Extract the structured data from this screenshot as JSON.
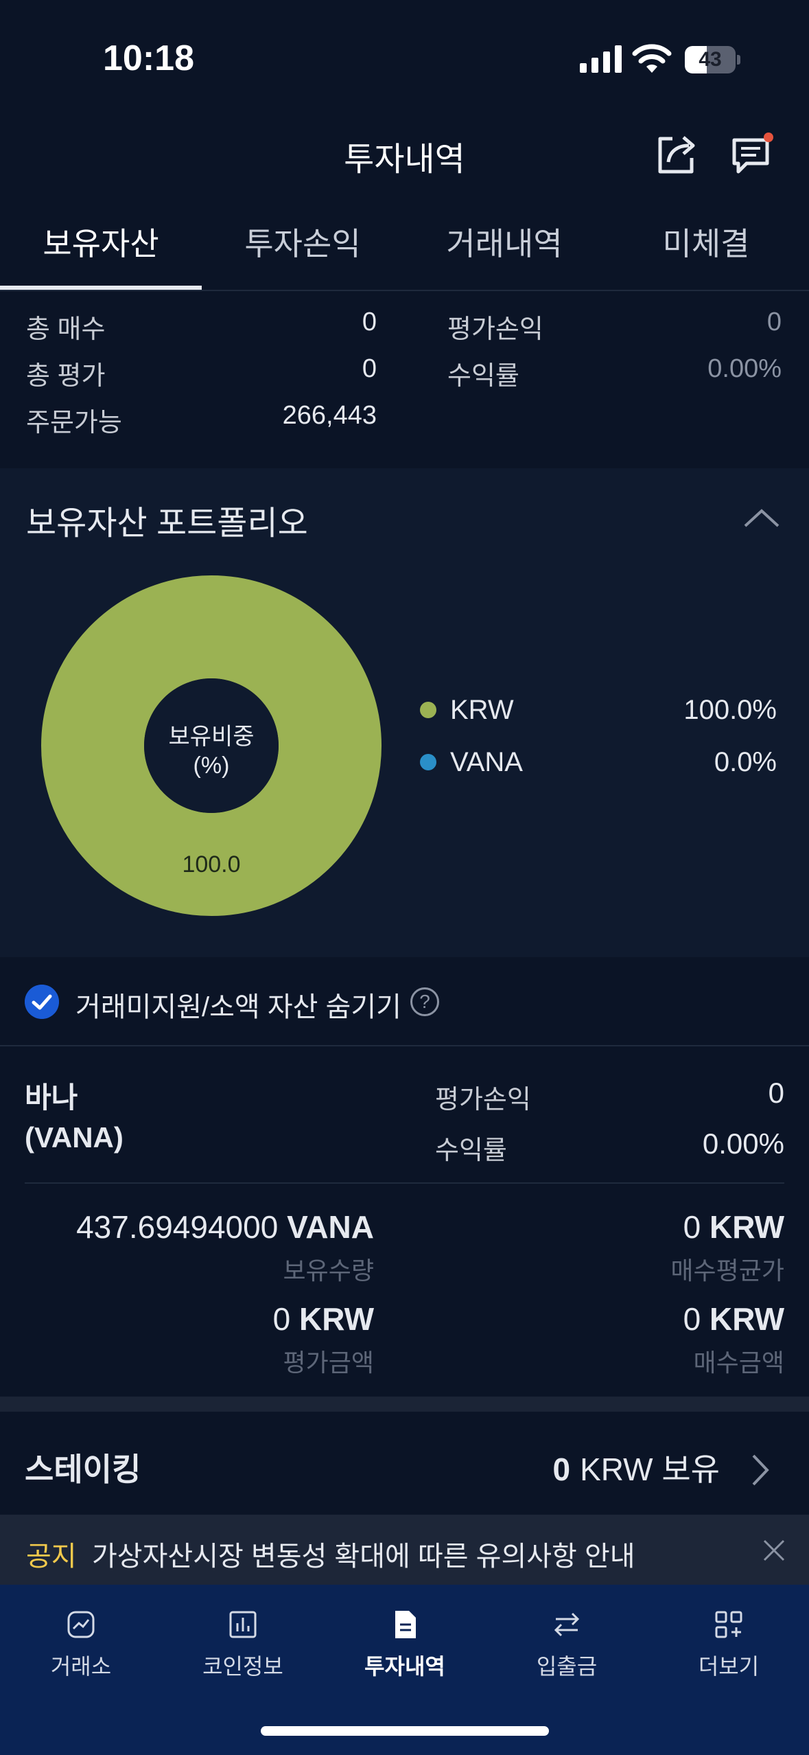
{
  "status_bar": {
    "time": "10:18",
    "battery": "43",
    "battery_level_percent": 43
  },
  "header": {
    "title": "투자내역"
  },
  "tabs": [
    {
      "label": "보유자산",
      "active": true
    },
    {
      "label": "투자손익",
      "active": false
    },
    {
      "label": "거래내역",
      "active": false
    },
    {
      "label": "미체결",
      "active": false
    }
  ],
  "summary": {
    "total_buy_label": "총 매수",
    "total_buy_value": "0",
    "total_eval_label": "총 평가",
    "total_eval_value": "0",
    "orderable_label": "주문가능",
    "orderable_value": "266,443",
    "pnl_label": "평가손익",
    "pnl_value": "0",
    "return_label": "수익률",
    "return_value": "0.00%"
  },
  "portfolio": {
    "title": "보유자산 포트폴리오",
    "center_label_line1": "보유비중",
    "center_label_line2": "(%)",
    "slice_label": "100.0",
    "legend": [
      {
        "name": "KRW",
        "value": "100.0%",
        "color": "#9bb253"
      },
      {
        "name": "VANA",
        "value": "0.0%",
        "color": "#2a8fc8"
      }
    ]
  },
  "chart_data": {
    "type": "pie",
    "title": "",
    "categories": [
      "KRW",
      "VANA"
    ],
    "values": [
      100.0,
      0.0
    ],
    "colors": [
      "#9bb253",
      "#2a8fc8"
    ]
  },
  "hide_small": {
    "label": "거래미지원/소액 자산 숨기기",
    "checked": true,
    "help": "?"
  },
  "holding": {
    "name_line1": "바나",
    "name_line2": "(VANA)",
    "pnl_label": "평가손익",
    "pnl_value": "0",
    "return_label": "수익률",
    "return_value": "0.00%",
    "qty_number": "437.69494000",
    "qty_unit": "VANA",
    "qty_label": "보유수량",
    "avg_number": "0",
    "avg_unit": "KRW",
    "avg_label": "매수평균가",
    "eval_number": "0",
    "eval_unit": "KRW",
    "eval_label": "평가금액",
    "buy_number": "0",
    "buy_unit": "KRW",
    "buy_label": "매수금액"
  },
  "staking": {
    "title": "스테이킹",
    "amount": "0",
    "suffix": "KRW 보유"
  },
  "notice": {
    "tag": "공지",
    "text": "가상자산시장 변동성 확대에 따른 유의사항 안내"
  },
  "bottom_nav": [
    {
      "label": "거래소",
      "icon": "exchange-chart-icon",
      "active": false
    },
    {
      "label": "코인정보",
      "icon": "bar-chart-icon",
      "active": false
    },
    {
      "label": "투자내역",
      "icon": "document-icon",
      "active": true
    },
    {
      "label": "입출금",
      "icon": "transfer-icon",
      "active": false
    },
    {
      "label": "더보기",
      "icon": "grid-plus-icon",
      "active": false
    }
  ],
  "colors": {
    "background": "#0b1426",
    "nav_background": "#0a2354",
    "accent": "#1a5bd6",
    "notice_tag": "#f2c94c"
  }
}
